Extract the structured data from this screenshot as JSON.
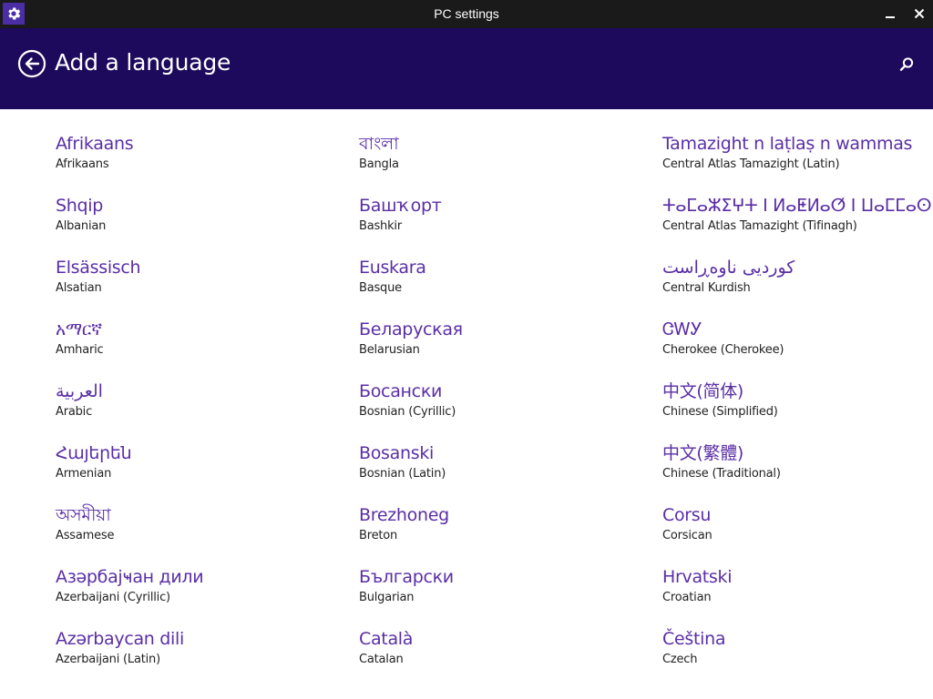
{
  "window": {
    "title": "PC settings",
    "icon": "gear-icon"
  },
  "header": {
    "title": "Add a language",
    "back_icon": "back-arrow-icon",
    "search_icon": "search-icon"
  },
  "colors": {
    "titlebar": "#1a1a1a",
    "header": "#1d0a5c",
    "accent": "#5a2ea6",
    "app_icon_bg": "#4b2da6"
  },
  "columns": [
    [
      {
        "native": "Afrikaans",
        "english": "Afrikaans"
      },
      {
        "native": "Shqip",
        "english": "Albanian"
      },
      {
        "native": "Elsässisch",
        "english": "Alsatian"
      },
      {
        "native": "አማርኛ",
        "english": "Amharic"
      },
      {
        "native": "العربية",
        "english": "Arabic"
      },
      {
        "native": "Հայերեն",
        "english": "Armenian"
      },
      {
        "native": "অসমীয়া",
        "english": "Assamese"
      },
      {
        "native": "Азәрбајҹан дили",
        "english": "Azerbaijani (Cyrillic)"
      },
      {
        "native": "Azərbaycan dili",
        "english": "Azerbaijani (Latin)"
      }
    ],
    [
      {
        "native": "বাংলা",
        "english": "Bangla"
      },
      {
        "native": "Башҡорт",
        "english": "Bashkir"
      },
      {
        "native": "Euskara",
        "english": "Basque"
      },
      {
        "native": "Беларуская",
        "english": "Belarusian"
      },
      {
        "native": "Босански",
        "english": "Bosnian (Cyrillic)"
      },
      {
        "native": "Bosanski",
        "english": "Bosnian (Latin)"
      },
      {
        "native": "Brezhoneg",
        "english": "Breton"
      },
      {
        "native": "Български",
        "english": "Bulgarian"
      },
      {
        "native": "Català",
        "english": "Catalan"
      }
    ],
    [
      {
        "native": "Tamazight n laṭlaṣ n wammas",
        "english": "Central Atlas Tamazight (Latin)"
      },
      {
        "native": "ⵜⴰⵎⴰⵣⵉⵖⵜ ⵏ ⵍⴰⵟⵍⴰⵚ ⵏ ⵡⴰⵎⵎⴰⵙ",
        "english": "Central Atlas Tamazight (Tifinagh)"
      },
      {
        "native": "کوردیی ناوەڕاست",
        "english": "Central Kurdish"
      },
      {
        "native": "ᏣᎳᎩ",
        "english": "Cherokee (Cherokee)"
      },
      {
        "native": "中文(简体)",
        "english": "Chinese (Simplified)"
      },
      {
        "native": "中文(繁體)",
        "english": "Chinese (Traditional)"
      },
      {
        "native": "Corsu",
        "english": "Corsican"
      },
      {
        "native": "Hrvatski",
        "english": "Croatian"
      },
      {
        "native": "Čeština",
        "english": "Czech"
      }
    ]
  ]
}
